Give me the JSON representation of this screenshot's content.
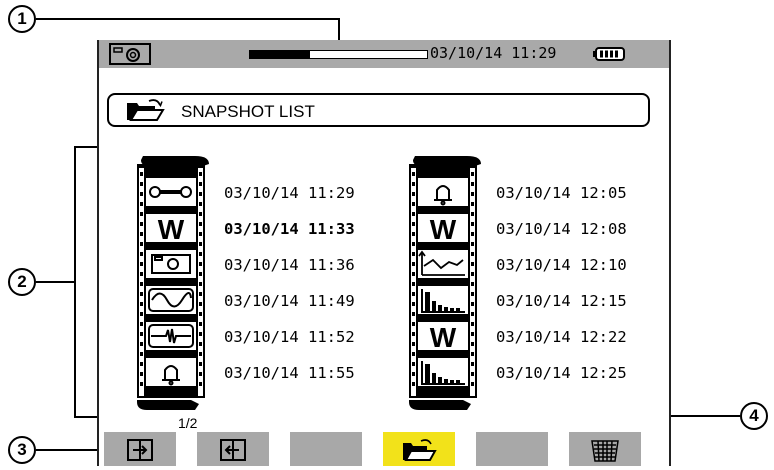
{
  "statusbar": {
    "datetime": "03/10/14 11:29",
    "progress": 0.34,
    "camera_icon": "camera-icon",
    "battery_icon": "battery-icon"
  },
  "header": {
    "title": "SNAPSHOT LIST",
    "icon": "open-folder-icon"
  },
  "columns": [
    {
      "entries": [
        {
          "icon": "wrench-icon",
          "text": "03/10/14 11:29",
          "bold": false
        },
        {
          "icon": "w-power-icon",
          "text": "03/10/14 11:33",
          "bold": true
        },
        {
          "icon": "camera-icon",
          "text": "03/10/14 11:36",
          "bold": false
        },
        {
          "icon": "waveform-icon",
          "text": "03/10/14 11:49",
          "bold": false
        },
        {
          "icon": "transient-icon",
          "text": "03/10/14 11:52",
          "bold": false
        },
        {
          "icon": "bell-icon",
          "text": "03/10/14 11:55",
          "bold": false
        }
      ]
    },
    {
      "entries": [
        {
          "icon": "bell-icon",
          "text": "03/10/14 12:05",
          "bold": false
        },
        {
          "icon": "w-power-icon",
          "text": "03/10/14 12:08",
          "bold": false
        },
        {
          "icon": "trend-icon",
          "text": "03/10/14 12:10",
          "bold": false
        },
        {
          "icon": "harmonics-icon",
          "text": "03/10/14 12:15",
          "bold": false
        },
        {
          "icon": "w-power-icon",
          "text": "03/10/14 12:22",
          "bold": false
        },
        {
          "icon": "harmonics-icon",
          "text": "03/10/14 12:25",
          "bold": false
        }
      ]
    }
  ],
  "page_indicator": "1/2",
  "softkeys": [
    {
      "icon": "page-forward-icon",
      "active": false
    },
    {
      "icon": "page-back-icon",
      "active": false
    },
    {
      "icon": "",
      "active": false
    },
    {
      "icon": "open-folder-icon",
      "active": true
    },
    {
      "icon": "",
      "active": false
    },
    {
      "icon": "trash-bin-icon",
      "active": false
    }
  ],
  "callouts": [
    "1",
    "2",
    "3",
    "4"
  ],
  "colors": {
    "statusbar": "#a9a9a9",
    "softkey": "#a8a8a8",
    "softkey_active": "#f2e21a"
  }
}
